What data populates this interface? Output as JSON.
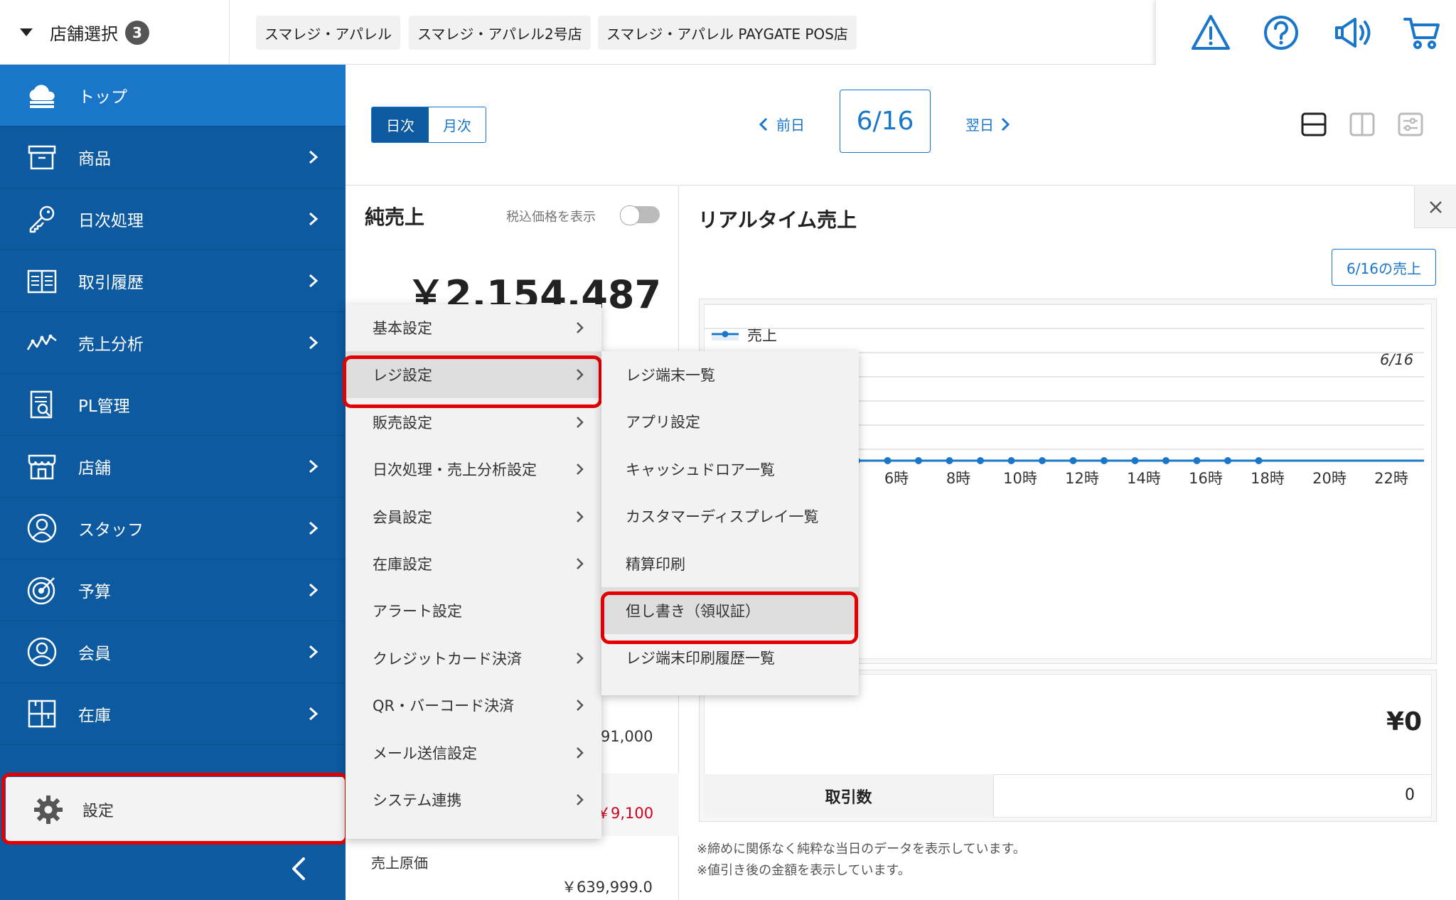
{
  "header": {
    "store_select_label": "店舗選択",
    "store_count": "3",
    "store_tabs": [
      "スマレジ・アパレル",
      "スマレジ・アパレル2号店",
      "スマレジ・アパレル PAYGATE POS店"
    ],
    "icons": [
      "warning-icon",
      "help-icon",
      "announcement-icon",
      "cart-icon"
    ]
  },
  "sidebar": {
    "items": [
      {
        "label": "トップ",
        "icon": "cloud-icon"
      },
      {
        "label": "商品",
        "icon": "box-icon"
      },
      {
        "label": "日次処理",
        "icon": "key-icon"
      },
      {
        "label": "取引履歴",
        "icon": "book-icon"
      },
      {
        "label": "売上分析",
        "icon": "analytics-icon"
      },
      {
        "label": "PL管理",
        "icon": "report-icon"
      },
      {
        "label": "店舗",
        "icon": "store-icon"
      },
      {
        "label": "スタッフ",
        "icon": "staff-icon"
      },
      {
        "label": "予算",
        "icon": "target-icon"
      },
      {
        "label": "会員",
        "icon": "member-icon"
      },
      {
        "label": "在庫",
        "icon": "inventory-icon"
      }
    ],
    "settings_label": "設定"
  },
  "toolbar": {
    "daily": "日次",
    "monthly": "月次",
    "prev": "前日",
    "date": "6/16",
    "next": "翌日"
  },
  "net_sales": {
    "title": "純売上",
    "tax_toggle_label": "税込価格を表示",
    "amount": "￥2,154,487",
    "row1_value": "91,000",
    "row2_value": "￥9,100",
    "cost_label": "売上原価",
    "cost_value": "￥639,999.0"
  },
  "realtime": {
    "title": "リアルタイム売上",
    "sales_button": "6/16の売上",
    "legend": "売上",
    "series_date": "6/16",
    "amount": "¥0",
    "tx_label": "取引数",
    "tx_value": "0",
    "note1": "※締めに関係なく純粋な当日のデータを表示しています。",
    "note2": "※値引き後の金額を表示しています。"
  },
  "chart_data": {
    "type": "line",
    "x_tick_labels": [
      "6時",
      "8時",
      "10時",
      "12時",
      "14時",
      "16時",
      "18時",
      "20時",
      "22時"
    ],
    "series": [
      {
        "name": "売上",
        "values": [
          0,
          0,
          0,
          0,
          0,
          0,
          0,
          0,
          0,
          0,
          0,
          0,
          0,
          0,
          0,
          0,
          0,
          0
        ]
      }
    ]
  },
  "menu": {
    "level1": [
      {
        "label": "基本設定",
        "sub": true
      },
      {
        "label": "レジ設定",
        "sub": true
      },
      {
        "label": "販売設定",
        "sub": true
      },
      {
        "label": "日次処理・売上分析設定",
        "sub": true
      },
      {
        "label": "会員設定",
        "sub": true
      },
      {
        "label": "在庫設定",
        "sub": true
      },
      {
        "label": "アラート設定",
        "sub": false
      },
      {
        "label": "クレジットカード決済",
        "sub": true
      },
      {
        "label": "QR・バーコード決済",
        "sub": true
      },
      {
        "label": "メール送信設定",
        "sub": true
      },
      {
        "label": "システム連携",
        "sub": true
      }
    ],
    "level2": [
      "レジ端末一覧",
      "アプリ設定",
      "キャッシュドロア一覧",
      "カスタマーディスプレイ一覧",
      "精算印刷",
      "但し書き（領収証）",
      "レジ端末印刷履歴一覧"
    ]
  },
  "colors": {
    "sidebar": "#0d5aa0",
    "sidebar_active": "#1976c8",
    "accent": "#1976c8",
    "highlight": "#e20000"
  }
}
